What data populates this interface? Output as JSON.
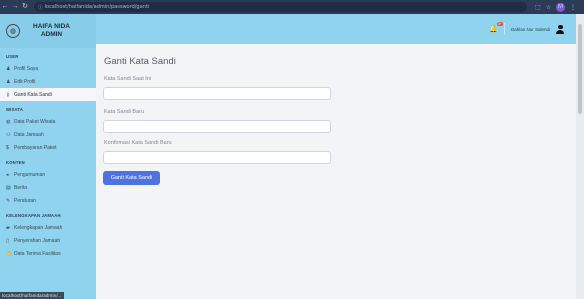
{
  "browser": {
    "url": "localhost/haifanida/admin/password/ganti",
    "profile_initial": "M"
  },
  "brand": {
    "line1": "HAIFA NIDA",
    "line2": "ADMIN"
  },
  "sidebar": {
    "sections": [
      {
        "title": "USER",
        "items": [
          {
            "label": "Profil Saya",
            "icon": "user-icon"
          },
          {
            "label": "Edit Profil",
            "icon": "user-edit-icon"
          },
          {
            "label": "Ganti Kata Sandi",
            "icon": "key-icon",
            "active": true
          }
        ]
      },
      {
        "title": "WISATA",
        "items": [
          {
            "label": "Data Paket Wisata",
            "icon": "globe-icon"
          },
          {
            "label": "Data Jamaah",
            "icon": "users-icon"
          },
          {
            "label": "Pembayaran Paket",
            "icon": "money-icon"
          }
        ]
      },
      {
        "title": "KONTEN",
        "items": [
          {
            "label": "Pengumuman",
            "icon": "megaphone-icon"
          },
          {
            "label": "Berita",
            "icon": "newspaper-icon"
          },
          {
            "label": "Peraturan",
            "icon": "pen-icon"
          }
        ]
      },
      {
        "title": "KELENGKAPAN JAMAAH",
        "items": [
          {
            "label": "Kelengkapan Jamaah",
            "icon": "briefcase-icon"
          },
          {
            "label": "Penyerahan Jamaah",
            "icon": "doc-icon"
          },
          {
            "label": "Data Terima Fasilitas",
            "icon": "hand-icon"
          }
        ]
      }
    ]
  },
  "status_url": "localhost/haifanida/admin/...",
  "topbar": {
    "notification_count": "3+",
    "user_name": "Dahlan Nur Salendi"
  },
  "form": {
    "title": "Ganti Kata Sandi",
    "current_label": "Kata Sandi Saat Ini",
    "new_label": "Kata Sandi Baru",
    "confirm_label": "Konfirmasi Kata Sandi Baru",
    "submit_label": "Ganti Kata Sandi"
  },
  "colors": {
    "sidebar": "#8fd3ee",
    "primary": "#4e73df",
    "browser": "#2b3a55"
  }
}
